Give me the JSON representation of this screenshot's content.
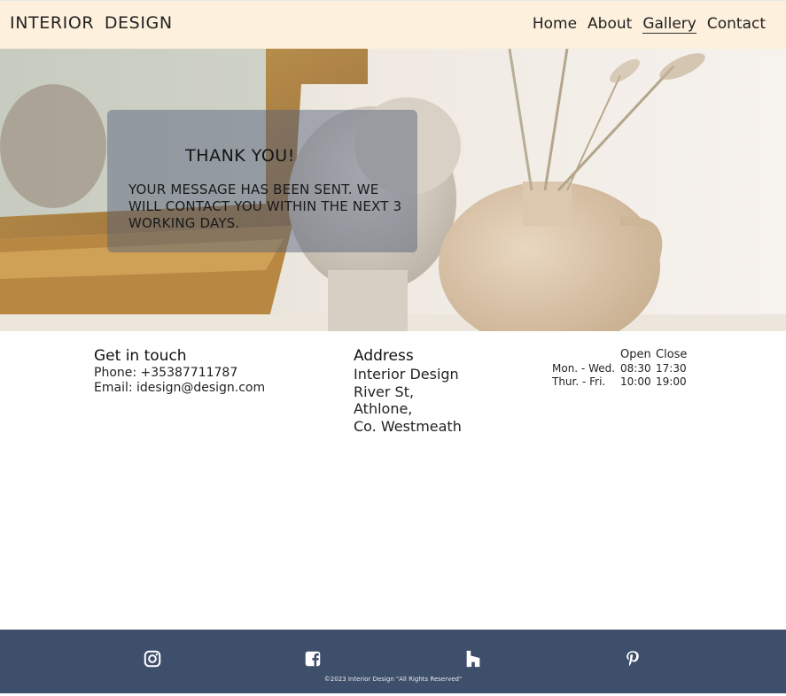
{
  "header": {
    "brand": "INTERIOR DESIGN",
    "nav": [
      {
        "label": "Home"
      },
      {
        "label": "About"
      },
      {
        "label": "Gallery"
      },
      {
        "label": "Contact"
      }
    ]
  },
  "hero": {
    "title": "THANK YOU!",
    "message": "YOUR MESSAGE HAS BEEN SENT. WE WILL CONTACT YOU WITHIN THE NEXT 3 WORKING DAYS."
  },
  "contact": {
    "heading": "Get in touch",
    "phone": "Phone: +35387711787",
    "email": "Email: idesign@design.com"
  },
  "address": {
    "heading": "Address",
    "lines": [
      "Interior Design",
      "River St,",
      "Athlone,",
      "Co. Westmeath"
    ]
  },
  "hours": {
    "headers": [
      "",
      "Open",
      "Close"
    ],
    "rows": [
      [
        "Mon. - Wed.",
        "08:30",
        "17:30"
      ],
      [
        "Thur. - Fri.",
        "10:00",
        "19:00"
      ]
    ]
  },
  "footer": {
    "social": [
      {
        "icon": "instagram-icon"
      },
      {
        "icon": "facebook-icon"
      },
      {
        "icon": "houzz-icon"
      },
      {
        "icon": "pinterest-icon"
      }
    ],
    "copyright": "©2023 Interior Design \"All Rights Reserved\""
  },
  "colors": {
    "header_bg": "#fdf0dc",
    "footer_bg": "#3e4f6b",
    "card_overlay": "rgba(84,96,122,0.48)"
  }
}
